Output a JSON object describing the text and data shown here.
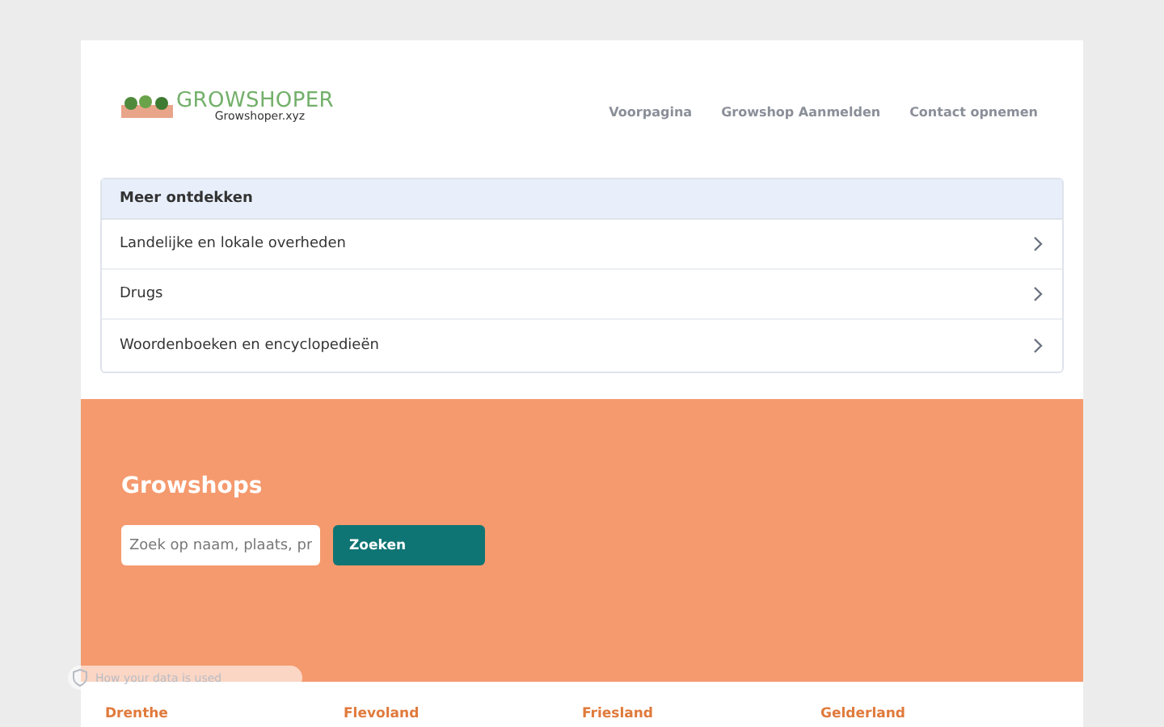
{
  "header": {
    "logo_title": "GROWSHOPER",
    "logo_subtitle": "Growshoper.xyz",
    "nav": [
      "Voorpagina",
      "Growshop Aanmelden",
      "Contact opnemen"
    ]
  },
  "discover": {
    "title": "Meer ontdekken",
    "items": [
      "Landelijke en lokale overheden",
      "Drugs",
      "Woordenboeken en encyclopedieën"
    ]
  },
  "hero": {
    "title": "Growshops",
    "search": {
      "placeholder": "Zoek op naam, plaats, pr"
    },
    "button": "Zoeken"
  },
  "provinces": [
    "Drenthe",
    "Flevoland",
    "Friesland",
    "Gelderland"
  ],
  "privacy_widget": {
    "label": "How your data is used"
  }
}
